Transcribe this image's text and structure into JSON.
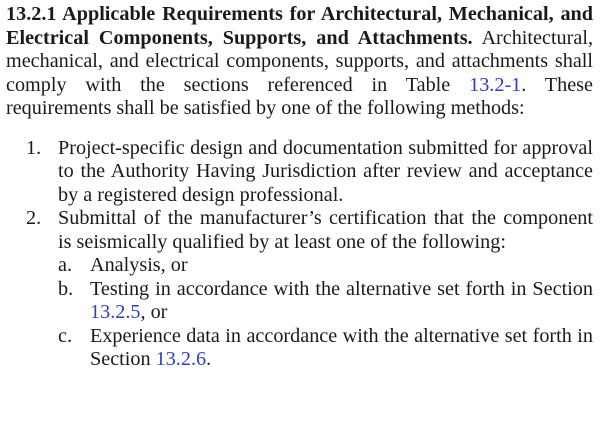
{
  "section": {
    "heading": "13.2.1 Applicable Requirements for Architectural, Mechanical, and Electrical Components, Supports, and Attachments.",
    "intro_before_ref": "Architectural, mechanical, and electrical components, supports, and attachments shall comply with the sections referenced in Table ",
    "intro_ref": "13.2-1",
    "intro_after_ref": ". These requirements shall be satisfied by one of the following methods:"
  },
  "methods": [
    {
      "marker": "1.",
      "text": "Project-specific design and documentation submitted for approval to the Authority Having Jurisdiction after review and acceptance by a registered design professional."
    },
    {
      "marker": "2.",
      "text": "Submittal of the manufacturer’s certification that the component is seismically qualified by at least one of the following:",
      "subitems": [
        {
          "marker": "a.",
          "text": "Analysis, or",
          "ref": "",
          "after": ""
        },
        {
          "marker": "b.",
          "text": "Testing in accordance with the alternative set forth in Section ",
          "ref": "13.2.5",
          "after": ", or"
        },
        {
          "marker": "c.",
          "text": "Experience data in accordance with the alternative set forth in Section ",
          "ref": "13.2.6",
          "after": "."
        }
      ]
    }
  ],
  "colors": {
    "text": "#1a1a1a",
    "link": "#2a3fc9",
    "background": "#ffffff"
  }
}
